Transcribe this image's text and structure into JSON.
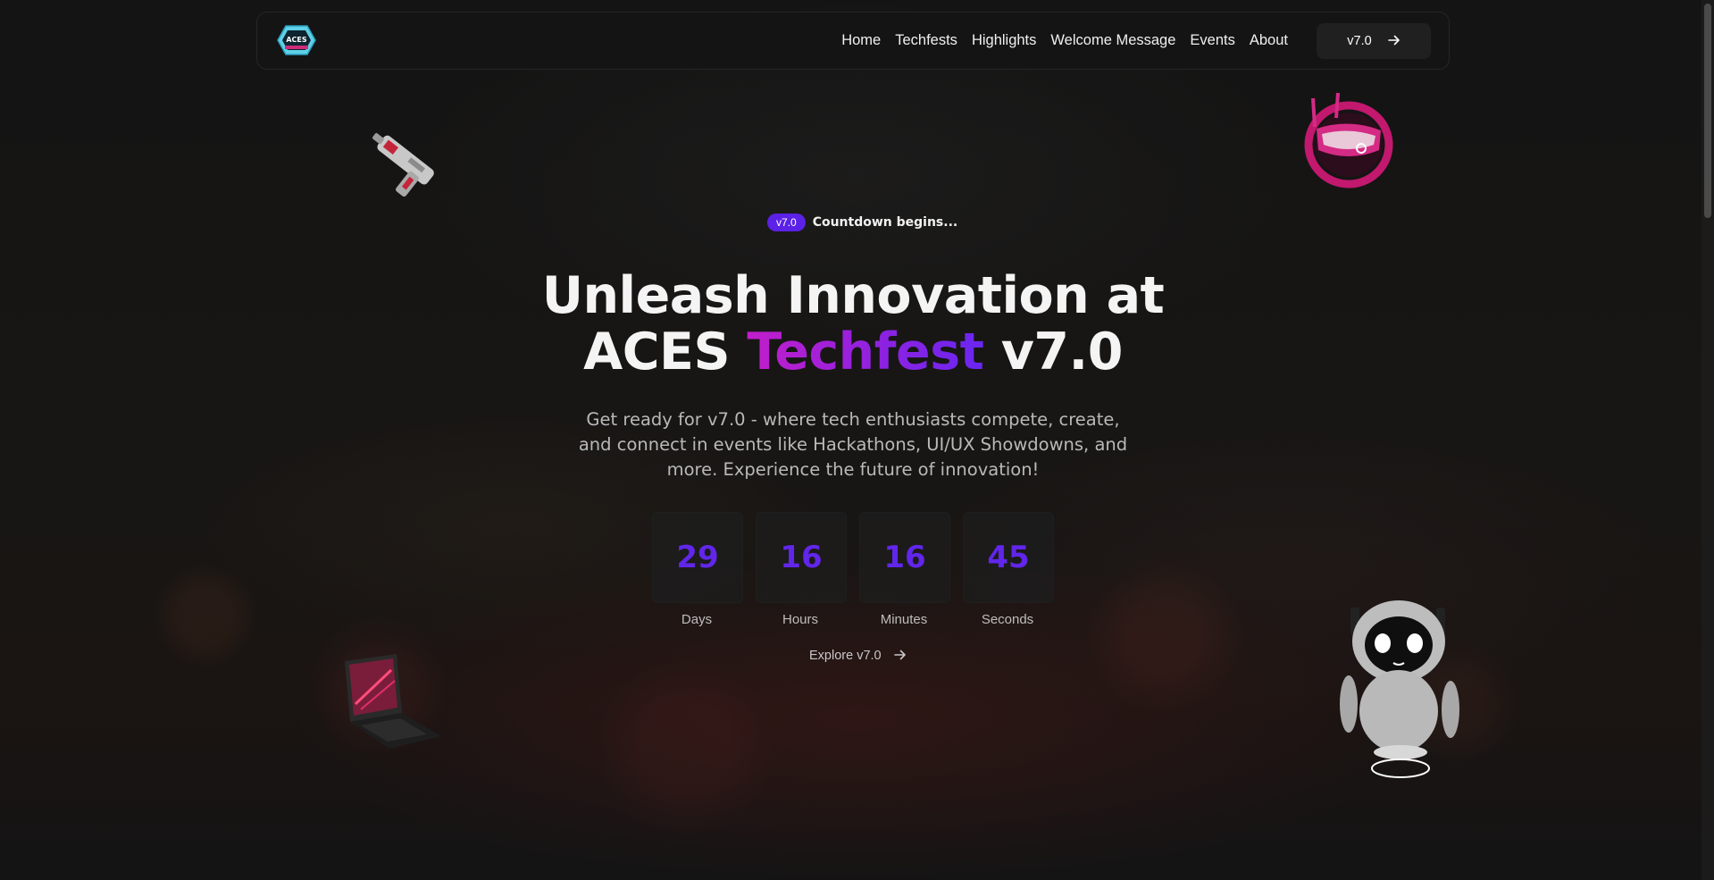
{
  "navbar": {
    "logo_text": "ACES",
    "links": [
      "Home",
      "Techfests",
      "Highlights",
      "Welcome Message",
      "Events",
      "About"
    ],
    "cta_label": "v7.0"
  },
  "hero": {
    "badge": "v7.0",
    "badge_text": "Countdown begins...",
    "headline_line1": "Unleash Innovation at",
    "headline_pre": "ACES",
    "headline_accent": "Techfest",
    "headline_post": "v7.0",
    "subtitle": "Get ready for v7.0 - where tech enthusiasts compete, create, and connect in events like Hackathons, UI/UX Showdowns, and more. Experience the future of innovation!",
    "countdown": [
      {
        "value": "29",
        "label": "Days"
      },
      {
        "value": "16",
        "label": "Hours"
      },
      {
        "value": "16",
        "label": "Minutes"
      },
      {
        "value": "45",
        "label": "Seconds"
      }
    ],
    "explore_label": "Explore v7.0"
  },
  "colors": {
    "accent_purple": "#6126ea",
    "accent_magenta": "#c21ecb",
    "background": "#151515"
  },
  "icons": {
    "nav_cta": "arrow-right-icon",
    "explore": "arrow-right-icon"
  }
}
